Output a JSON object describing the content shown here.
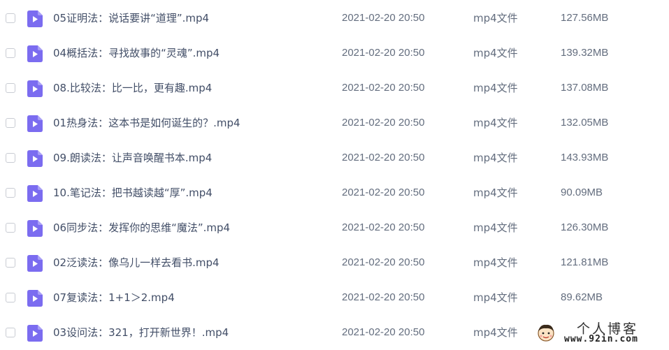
{
  "files": [
    {
      "name": "05证明法：说话要讲“道理”.mp4",
      "date": "2021-02-20 20:50",
      "type": "mp4文件",
      "size": "127.56MB"
    },
    {
      "name": "04概括法：寻找故事的“灵魂”.mp4",
      "date": "2021-02-20 20:50",
      "type": "mp4文件",
      "size": "139.32MB"
    },
    {
      "name": "08.比较法：比一比，更有趣.mp4",
      "date": "2021-02-20 20:50",
      "type": "mp4文件",
      "size": "137.08MB"
    },
    {
      "name": "01热身法：这本书是如何诞生的？.mp4",
      "date": "2021-02-20 20:50",
      "type": "mp4文件",
      "size": "132.05MB"
    },
    {
      "name": "09.朗读法：让声音唤醒书本.mp4",
      "date": "2021-02-20 20:50",
      "type": "mp4文件",
      "size": "143.93MB"
    },
    {
      "name": "10.笔记法：把书越读越“厚”.mp4",
      "date": "2021-02-20 20:50",
      "type": "mp4文件",
      "size": "90.09MB"
    },
    {
      "name": "06同步法：发挥你的思维“魔法”.mp4",
      "date": "2021-02-20 20:50",
      "type": "mp4文件",
      "size": "126.30MB"
    },
    {
      "name": "02泛读法：像乌儿一样去看书.mp4",
      "date": "2021-02-20 20:50",
      "type": "mp4文件",
      "size": "121.81MB"
    },
    {
      "name": "07复读法：1+1＞2.mp4",
      "date": "2021-02-20 20:50",
      "type": "mp4文件",
      "size": "89.62MB"
    },
    {
      "name": "03设问法：321，打开新世界！.mp4",
      "date": "2021-02-20 20:50",
      "type": "mp4文件",
      "size": ""
    }
  ],
  "icons": {
    "file": "video-file-icon",
    "checkbox": "checkbox"
  },
  "colors": {
    "icon_purple": "#7b6cf0",
    "text_primary": "#424e67",
    "text_secondary": "#636d7e",
    "checkbox_border": "#c9ccd3"
  },
  "watermark": {
    "title": "个人博客",
    "url": "www.92in.com"
  }
}
